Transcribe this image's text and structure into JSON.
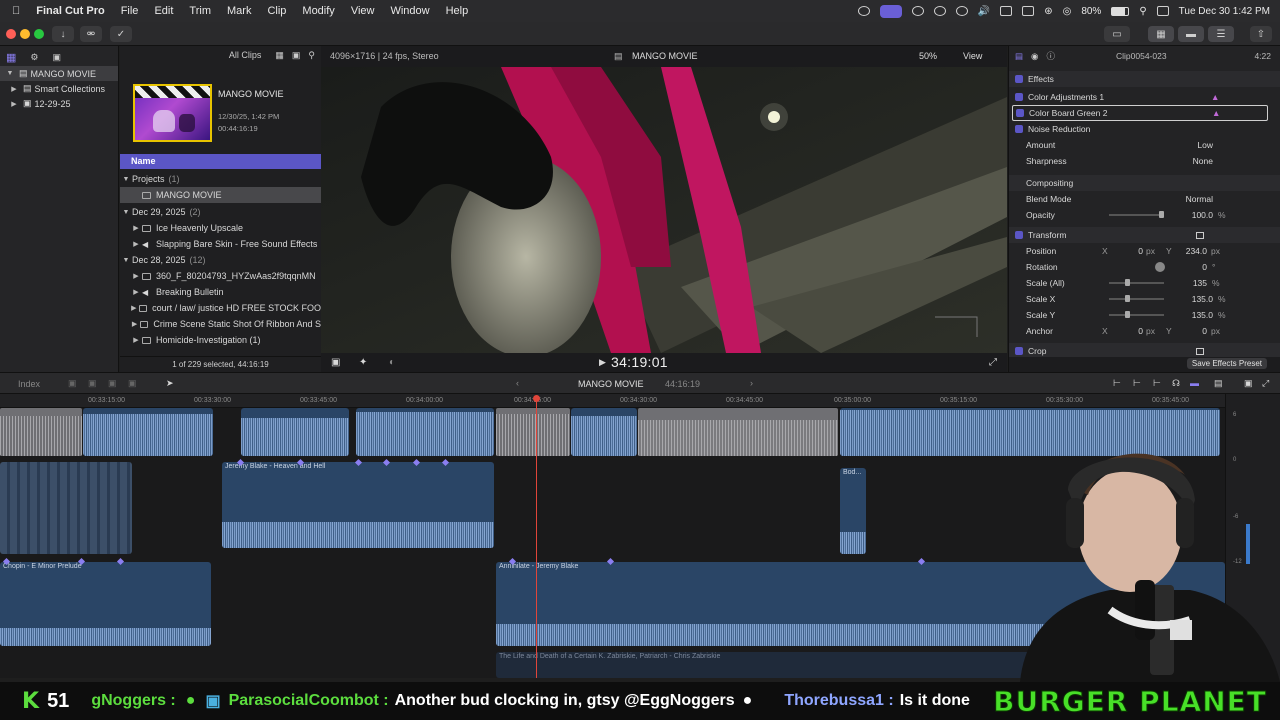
{
  "menubar": {
    "app": "Final Cut Pro",
    "items": [
      "File",
      "Edit",
      "Trim",
      "Mark",
      "Clip",
      "Modify",
      "View",
      "Window",
      "Help"
    ],
    "battery": "80%",
    "clock": "Tue Dec 30  1:42 PM"
  },
  "library": {
    "rows": [
      {
        "label": "MANGO MOVIE"
      },
      {
        "label": "Smart Collections"
      },
      {
        "label": "12-29-25"
      }
    ]
  },
  "browser": {
    "filter": "All Clips",
    "project": {
      "name": "MANGO MOVIE",
      "date": "12/30/25, 1:42 PM",
      "duration": "00:44:16:19"
    },
    "name_header": "Name",
    "groups": [
      {
        "label": "Projects",
        "count": "(1)"
      },
      {
        "label": "Dec 29, 2025",
        "count": "(2)"
      },
      {
        "label": "Dec 28, 2025",
        "count": "(12)"
      }
    ],
    "items": [
      "MANGO MOVIE",
      "Ice Heavenly Upscale",
      "Slapping Bare Skin - Free Sound Effects",
      "360_F_80204793_HYZwAas2f9tqqnMN",
      "Breaking Bulletin",
      "court / law/ justice HD FREE STOCK FOO",
      "Crime Scene Static Shot Of Ribbon And S",
      "Homicide-Investigation (1)"
    ],
    "footer": "1 of 229 selected, 44:16:19"
  },
  "viewer": {
    "format": "4096×1716 | 24 fps, Stereo",
    "title": "MANGO MOVIE",
    "zoom": "50%",
    "view": "View",
    "timecode": "34:19:01"
  },
  "inspector": {
    "clip": "Clip0054-023",
    "duration": "4:22",
    "effects_label": "Effects",
    "effect1": "Color Adjustments 1",
    "effect2": "Color Board Green 2",
    "noise": "Noise Reduction",
    "amount_label": "Amount",
    "amount_val": "Low",
    "sharp_label": "Sharpness",
    "sharp_val": "None",
    "compositing": "Compositing",
    "blend_label": "Blend Mode",
    "blend_val": "Normal",
    "opacity_label": "Opacity",
    "opacity_val": "100.0",
    "pct": "%",
    "transform": "Transform",
    "pos_label": "Position",
    "pos_x": "0",
    "pos_y": "234.0",
    "px": "px",
    "X": "X",
    "Y": "Y",
    "rot_label": "Rotation",
    "rot_val": "0",
    "deg": "°",
    "scale_all_label": "Scale (All)",
    "scale_all_val": "135",
    "scalex_label": "Scale X",
    "scalex_val": "135.0",
    "scaley_label": "Scale Y",
    "scaley_val": "135.0",
    "anchor_label": "Anchor",
    "anchor_x": "0",
    "anchor_y": "0",
    "crop": "Crop",
    "save_preset": "Save Effects Preset"
  },
  "timeline": {
    "index": "Index",
    "project": "MANGO MOVIE",
    "duration": "44:16:19",
    "ruler": [
      "00:33:15:00",
      "00:33:30:00",
      "00:33:45:00",
      "00:34:00:00",
      "00:34:15:00",
      "00:34:30:00",
      "00:34:45:00",
      "00:35:00:00",
      "00:35:15:00",
      "00:35:30:00",
      "00:35:45:00"
    ],
    "clips": {
      "heaven": "Jeremy Blake - Heaven and Hell",
      "bod": "Bod...",
      "chopin": "Chopin - E Minor Prelude",
      "annihilate": "Annihilate - Jeremy Blake",
      "zabriskie": "The Life and Death of a Certain K. Zabriskie, Patriarch - Chris Zabriskie"
    },
    "meter_ticks": [
      "6",
      "0",
      "-6",
      "-12"
    ]
  },
  "ticker": {
    "count": "51",
    "msg1_user": "gNoggers :",
    "msg2_user": "ParasocialCoombot :",
    "msg2_text": "Another bud clocking in, gtsy @EggNoggers",
    "msg3_user": "Thorebussa1 :",
    "msg3_text": "Is it done",
    "burger": "BURGER PLANET"
  }
}
